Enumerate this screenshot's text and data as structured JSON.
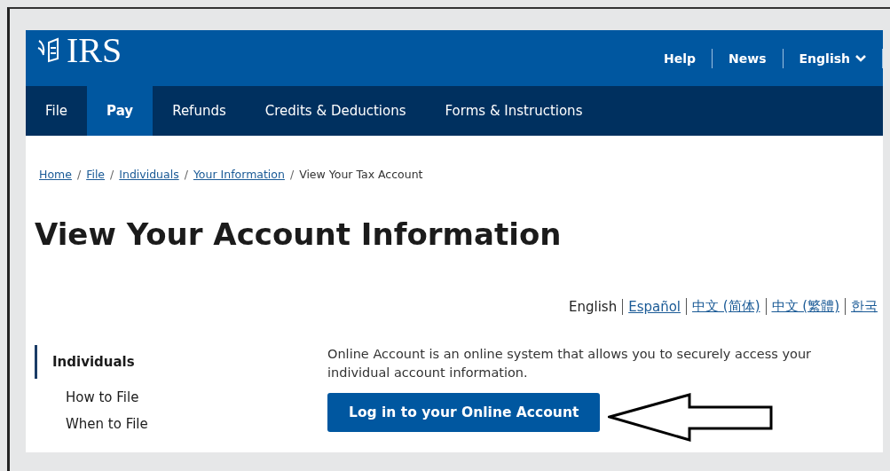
{
  "header": {
    "logo": "IRS",
    "utility_links": [
      {
        "label": "Help",
        "kind": "link"
      },
      {
        "label": "News",
        "kind": "link"
      },
      {
        "label": "English",
        "kind": "dropdown"
      }
    ]
  },
  "nav": [
    {
      "label": "File",
      "selected": false
    },
    {
      "label": "Pay",
      "selected": true
    },
    {
      "label": "Refunds",
      "selected": false
    },
    {
      "label": "Credits & Deductions",
      "selected": false
    },
    {
      "label": "Forms & Instructions",
      "selected": false
    }
  ],
  "breadcrumb_separator": "/",
  "breadcrumbs": [
    {
      "label": "Home",
      "kind": "link"
    },
    {
      "label": "File",
      "kind": "link"
    },
    {
      "label": "Individuals",
      "kind": "link"
    },
    {
      "label": "Your Information",
      "kind": "link"
    },
    {
      "label": "View Your Tax Account",
      "kind": "current"
    }
  ],
  "title": "View Your Account Information",
  "languages": [
    {
      "label": "English",
      "selected": true
    },
    {
      "label": "Español",
      "selected": false
    },
    {
      "label": "中文 (简体)",
      "selected": false
    },
    {
      "label": "中文 (繁體)",
      "selected": false
    },
    {
      "label": "한국",
      "selected": false
    }
  ],
  "sidebar": {
    "items": [
      {
        "label": "Individuals",
        "selected": true
      },
      {
        "label": "How to File",
        "selected": false
      },
      {
        "label": "When to File",
        "selected": false
      }
    ]
  },
  "intro": "Online Account is an online system that allows you to securely access your individual account information.",
  "login_button": "Log in to your Online Account"
}
